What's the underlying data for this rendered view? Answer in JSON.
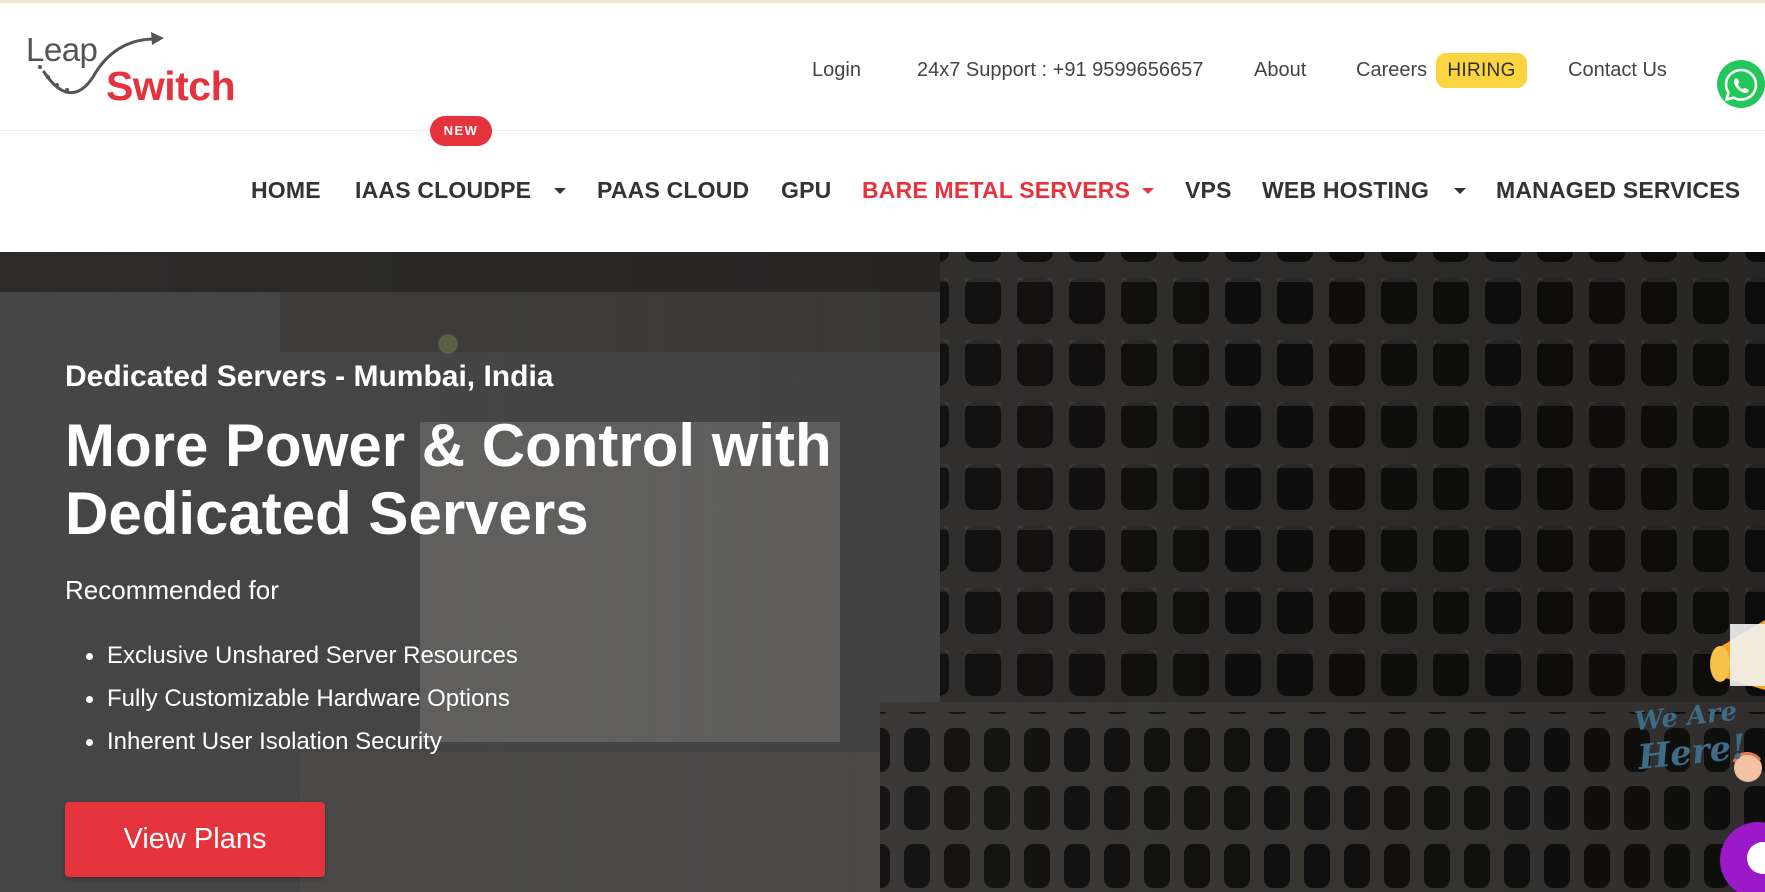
{
  "brand": {
    "logo_leap": "Leap",
    "logo_switch": "Switch",
    "accent_color": "#e5333d",
    "highlight_color": "#fbd442",
    "whatsapp_color": "#25c659"
  },
  "topbar": {
    "login": "Login",
    "support": "24x7 Support : +91 9599656657",
    "about": "About",
    "careers": "Careers",
    "hiring_badge": "HIRING",
    "contact": "Contact Us",
    "whatsapp_icon": "whatsapp-icon"
  },
  "nav": {
    "new_badge": "NEW",
    "items": [
      {
        "label": "HOME"
      },
      {
        "label": "IAAS CLOUDPE"
      },
      {
        "label": "PAAS CLOUD"
      },
      {
        "label": "GPU"
      },
      {
        "label": "BARE METAL SERVERS"
      },
      {
        "label": "VPS"
      },
      {
        "label": "WEB HOSTING"
      },
      {
        "label": "MANAGED SERVICES"
      }
    ],
    "active": "BARE METAL SERVERS"
  },
  "hero": {
    "subtitle": "Dedicated Servers - Mumbai, India",
    "title": "More Power & Control with Dedicated Servers",
    "recommended": "Recommended for",
    "features": [
      "Exclusive Unshared Server Resources",
      "Fully Customizable Hardware Options",
      "Inherent User Isolation Security"
    ],
    "cta": "View Plans"
  },
  "widget": {
    "line1": "We Are",
    "line2": "Here!"
  }
}
